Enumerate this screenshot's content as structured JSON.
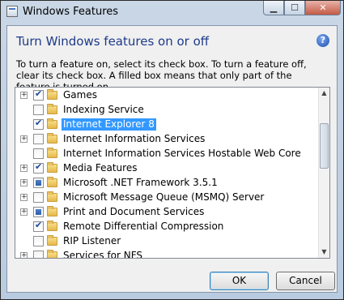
{
  "window": {
    "title": "Windows Features",
    "caption_buttons": {
      "minimize": "▁",
      "maximize": "☐",
      "close": "✕"
    }
  },
  "heading": "Turn Windows features on or off",
  "help_label": "?",
  "instructions": "To turn a feature on, select its check box. To turn a feature off, clear its check box. A filled box means that only part of the feature is turned on.",
  "features": [
    {
      "label": "Games",
      "state": "checked",
      "expandable": true,
      "selected": false
    },
    {
      "label": "Indexing Service",
      "state": "unchecked",
      "expandable": false,
      "selected": false
    },
    {
      "label": "Internet Explorer 8",
      "state": "checked",
      "expandable": false,
      "selected": true
    },
    {
      "label": "Internet Information Services",
      "state": "unchecked",
      "expandable": true,
      "selected": false
    },
    {
      "label": "Internet Information Services Hostable Web Core",
      "state": "unchecked",
      "expandable": false,
      "selected": false
    },
    {
      "label": "Media Features",
      "state": "checked",
      "expandable": true,
      "selected": false
    },
    {
      "label": "Microsoft .NET Framework 3.5.1",
      "state": "partial",
      "expandable": true,
      "selected": false
    },
    {
      "label": "Microsoft Message Queue (MSMQ) Server",
      "state": "unchecked",
      "expandable": true,
      "selected": false
    },
    {
      "label": "Print and Document Services",
      "state": "partial",
      "expandable": true,
      "selected": false
    },
    {
      "label": "Remote Differential Compression",
      "state": "checked",
      "expandable": false,
      "selected": false
    },
    {
      "label": "RIP Listener",
      "state": "unchecked",
      "expandable": false,
      "selected": false
    },
    {
      "label": "Services for NFS",
      "state": "unchecked",
      "expandable": true,
      "selected": false
    }
  ],
  "buttons": {
    "ok": "OK",
    "cancel": "Cancel"
  },
  "colors": {
    "heading": "#1e3a8a",
    "selection": "#3399ff",
    "partial_fill": "#2e5fa8"
  }
}
